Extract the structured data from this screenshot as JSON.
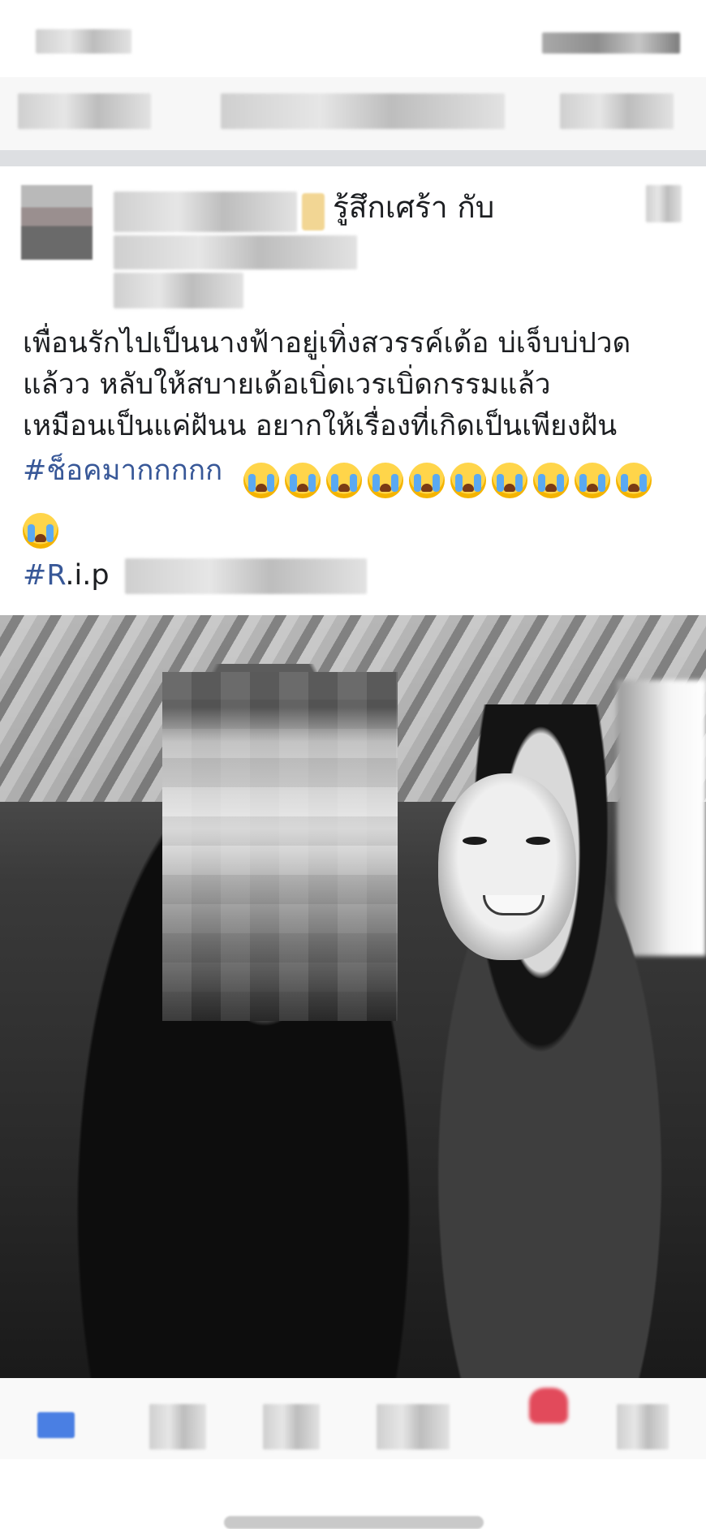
{
  "post": {
    "feeling": "รู้สึกเศร้า กับ",
    "body_lines": [
      "เพื่อนรักไปเป็นนางฟ้าอยู่เทิ่งสวรรค์เด้อ บ่เจ็บบ่ปวด",
      "แล้วว หลับให้สบายเด้อเบิ่ดเวรเบิ่ดกรรมแล้ว",
      "เหมือนเป็นแค่ฝันน อยากให้เรื่องที่เกิดเป็นเพียงฝัน"
    ],
    "hashtag_shock": "#ช็อคมากกกกก",
    "crying_emoji_count": 11,
    "rip_hashtag_prefix": "#R",
    "rip_suffix": ".i.p"
  },
  "colors": {
    "hashtag": "#385898",
    "text": "#1c1e21",
    "separator": "#dddfe2",
    "like_blue": "#4a7fe3",
    "heart_red": "#e24a5b"
  },
  "icons": {
    "more": "more-options-icon",
    "like": "like-icon",
    "reaction": "heart-icon",
    "emoji": "loudly-crying-face-icon"
  }
}
